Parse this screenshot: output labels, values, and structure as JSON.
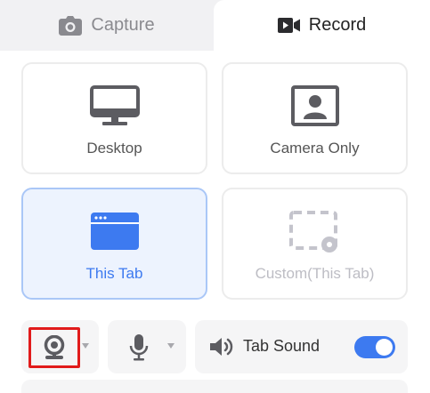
{
  "tabs": {
    "capture": {
      "label": "Capture",
      "icon": "camera-icon",
      "active": false
    },
    "record": {
      "label": "Record",
      "icon": "video-camera-icon",
      "active": true
    }
  },
  "modes": {
    "desktop": {
      "label": "Desktop",
      "icon": "monitor-icon",
      "state": "normal"
    },
    "camera_only": {
      "label": "Camera Only",
      "icon": "portrait-icon",
      "state": "normal"
    },
    "this_tab": {
      "label": "This Tab",
      "icon": "browser-window-icon",
      "state": "selected"
    },
    "custom": {
      "label": "Custom(This Tab)",
      "icon": "dashed-region-icon",
      "state": "disabled"
    }
  },
  "controls": {
    "webcam": {
      "icon": "webcam-icon",
      "dropdown": true
    },
    "microphone": {
      "icon": "microphone-icon",
      "dropdown": true
    },
    "tab_sound": {
      "label": "Tab Sound",
      "icon": "speaker-icon",
      "enabled": true
    }
  },
  "colors": {
    "accent": "#3d7af0",
    "selected_bg": "#edf3fe",
    "highlight_border": "#e11b1b",
    "icon_gray": "#5c5c61",
    "disabled_gray": "#bdbdc4"
  }
}
